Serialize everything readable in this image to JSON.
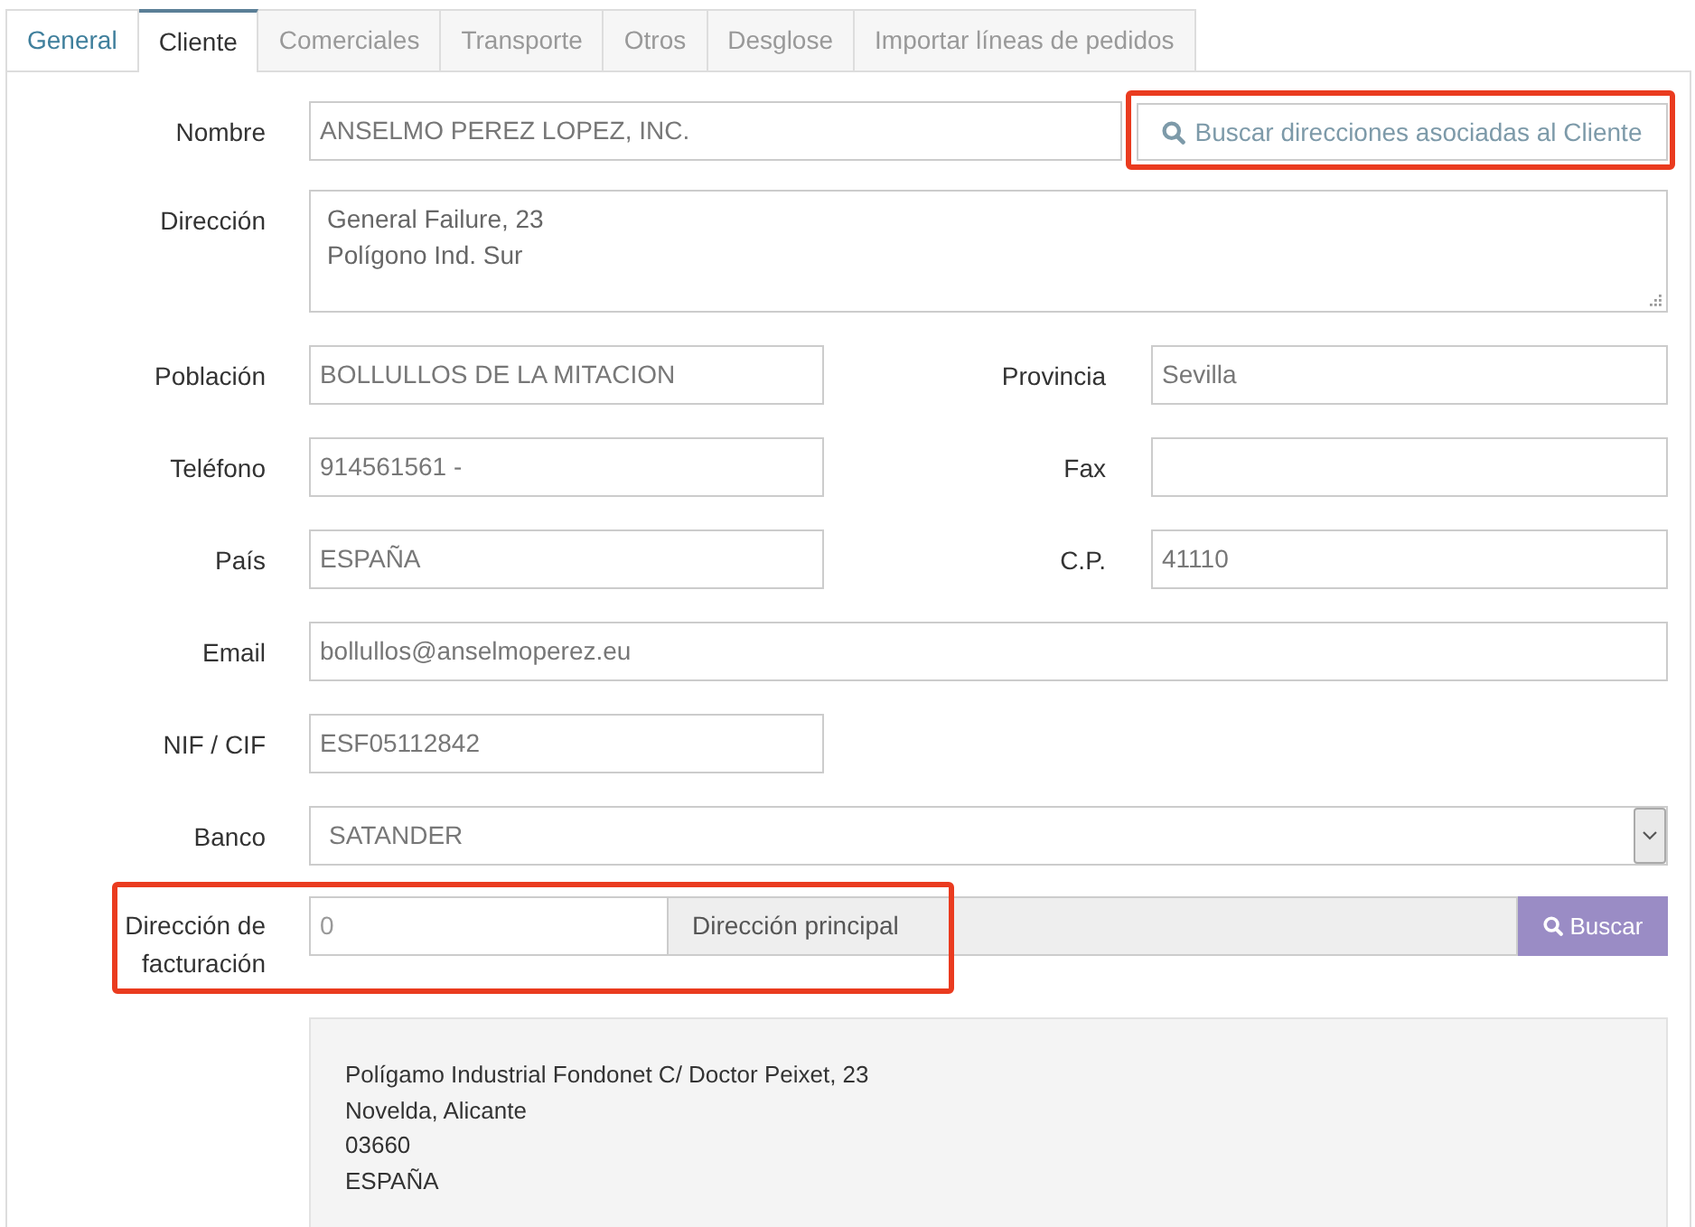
{
  "tabs": [
    {
      "label": "General",
      "selected": false,
      "hovered": true
    },
    {
      "label": "Cliente",
      "selected": true,
      "hovered": false
    },
    {
      "label": "Comerciales",
      "selected": false,
      "hovered": false
    },
    {
      "label": "Transporte",
      "selected": false,
      "hovered": false
    },
    {
      "label": "Otros",
      "selected": false,
      "hovered": false
    },
    {
      "label": "Desglose",
      "selected": false,
      "hovered": false
    },
    {
      "label": "Importar líneas de pedidos",
      "selected": false,
      "hovered": false
    }
  ],
  "form": {
    "name": {
      "label": "Nombre",
      "value": "ANSELMO PEREZ LOPEZ, INC.",
      "search_button": {
        "label": "Buscar direcciones asociadas al Cliente",
        "highlighted": true
      }
    },
    "address": {
      "label": "Dirección",
      "value": "General Failure, 23\nPolígono Ind. Sur"
    },
    "rows": [
      {
        "kind": "pair",
        "fields": [
          {
            "label": "Población",
            "value": "BOLLULLOS DE LA MITACION"
          },
          {
            "label": "Provincia",
            "value": "Sevilla"
          }
        ]
      },
      {
        "kind": "pair",
        "fields": [
          {
            "label": "Teléfono",
            "value": "914561561 -"
          },
          {
            "label": "Fax"
          }
        ]
      },
      {
        "kind": "pair",
        "fields": [
          {
            "label": "País",
            "value": "ESPAÑA"
          },
          {
            "label": "C.P.",
            "value": "41110"
          }
        ]
      },
      {
        "kind": "wide",
        "fields": [
          {
            "label": "Email",
            "value": "bollullos@anselmoperez.eu"
          }
        ]
      },
      {
        "kind": "half",
        "fields": [
          {
            "label": "NIF / CIF",
            "value": "ESF05112842"
          }
        ]
      },
      {
        "kind": "select",
        "fields": [
          {
            "label": "Banco",
            "value": "SATANDER"
          }
        ]
      }
    ],
    "billing_address": {
      "label": "Dirección de facturación",
      "code": "0",
      "name": "Dirección principal",
      "button": "Buscar",
      "highlighted": true,
      "details": [
        "Polígamo Industrial Fondonet C/ Doctor Peixet, 23",
        "Novelda, Alicante",
        "03660",
        "ESPAÑA"
      ]
    }
  }
}
